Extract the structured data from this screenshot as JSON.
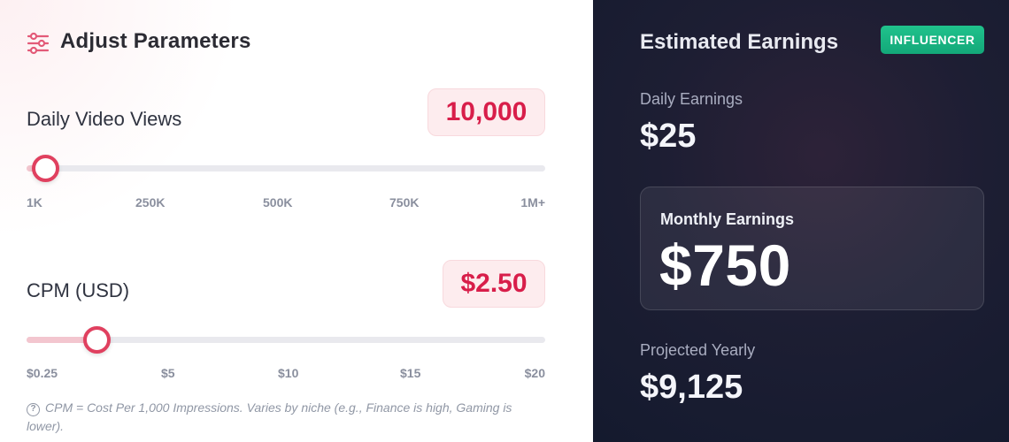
{
  "left_panel": {
    "title": "Adjust Parameters",
    "title_icon": "sliders-icon",
    "views": {
      "label": "Daily Video Views",
      "value_display": "10,000",
      "slider_fraction": 0.036,
      "tick_labels": [
        "1K",
        "250K",
        "500K",
        "750K",
        "1M+"
      ]
    },
    "cpm": {
      "label": "CPM (USD)",
      "value_display": "$2.50",
      "slider_fraction": 0.135,
      "tick_labels": [
        "$0.25",
        "$5",
        "$10",
        "$15",
        "$20"
      ]
    },
    "note": {
      "icon": "question-circle-icon",
      "icon_glyph": "?",
      "text": "CPM = Cost Per 1,000 Impressions. Varies by niche (e.g., Finance is high, Gaming is lower)."
    }
  },
  "right_panel": {
    "title": "Estimated Earnings",
    "badge": "INFLUENCER",
    "daily_label": "Daily Earnings",
    "daily_value": "$25",
    "monthly_label": "Monthly Earnings",
    "monthly_value": "$750",
    "yearly_label": "Projected Yearly",
    "yearly_value": "$9,125"
  },
  "colors": {
    "accent": "#e0405f",
    "accent_text": "#d81e4a",
    "badge": "#18b583",
    "dark_panel": "#1d1e33"
  }
}
